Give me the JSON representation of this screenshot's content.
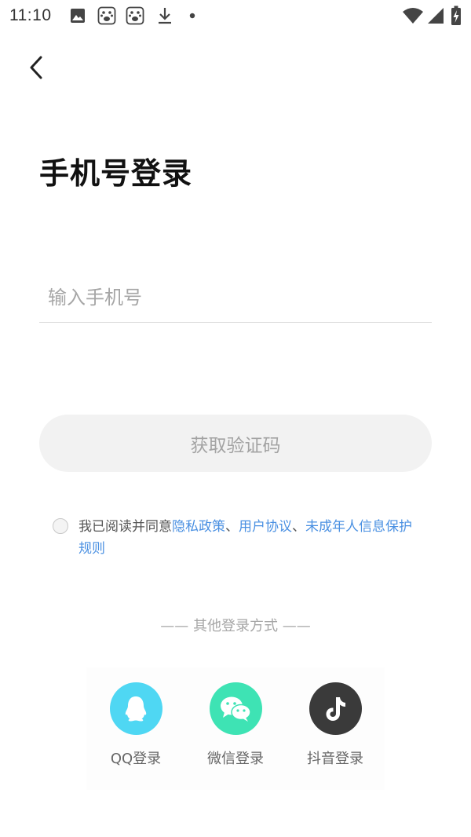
{
  "status_bar": {
    "time": "11:10"
  },
  "header": {
    "back_icon": "chevron-left-icon"
  },
  "title": "手机号登录",
  "phone_input": {
    "value": "",
    "placeholder": "输入手机号"
  },
  "code_button_label": "获取验证码",
  "agreement": {
    "prefix": "我已阅读并同意",
    "link_privacy": "隐私政策",
    "sep1": "、",
    "link_user": "用户协议",
    "sep2": "、",
    "link_minor": "未成年人信息保护规则",
    "link_color": "#4a90e2"
  },
  "other_login_label": "—— 其他登录方式 ——",
  "social": [
    {
      "label": "QQ登录",
      "icon": "qq-icon",
      "color": "#4fd7f3"
    },
    {
      "label": "微信登录",
      "icon": "wechat-icon",
      "color": "#3ee3b4"
    },
    {
      "label": "抖音登录",
      "icon": "tiktok-icon",
      "color": "#3a3a3a"
    }
  ]
}
